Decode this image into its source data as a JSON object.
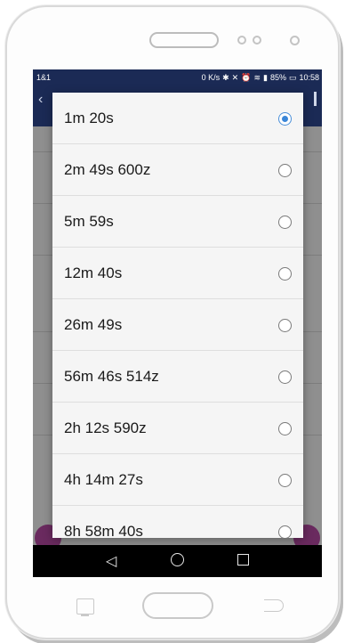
{
  "status_bar": {
    "carrier": "1&1",
    "speed": "0 K/s",
    "icons": [
      "bluetooth-icon",
      "mute-icon",
      "alarm-icon",
      "wifi-icon",
      "signal-icon"
    ],
    "battery": "85%",
    "time": "10:58"
  },
  "dialog": {
    "options": [
      {
        "label": "1m 20s",
        "selected": true
      },
      {
        "label": "2m 49s 600z",
        "selected": false
      },
      {
        "label": "5m 59s",
        "selected": false
      },
      {
        "label": "12m 40s",
        "selected": false
      },
      {
        "label": "26m 49s",
        "selected": false
      },
      {
        "label": "56m 46s 514z",
        "selected": false
      },
      {
        "label": "2h 12s 590z",
        "selected": false
      },
      {
        "label": "4h 14m 27s",
        "selected": false
      },
      {
        "label": "8h 58m 40s",
        "selected": false
      }
    ]
  },
  "colors": {
    "status_bar": "#1b2a55",
    "radio_selected": "#3a86d8",
    "accent_button": "#6a2a5f"
  }
}
